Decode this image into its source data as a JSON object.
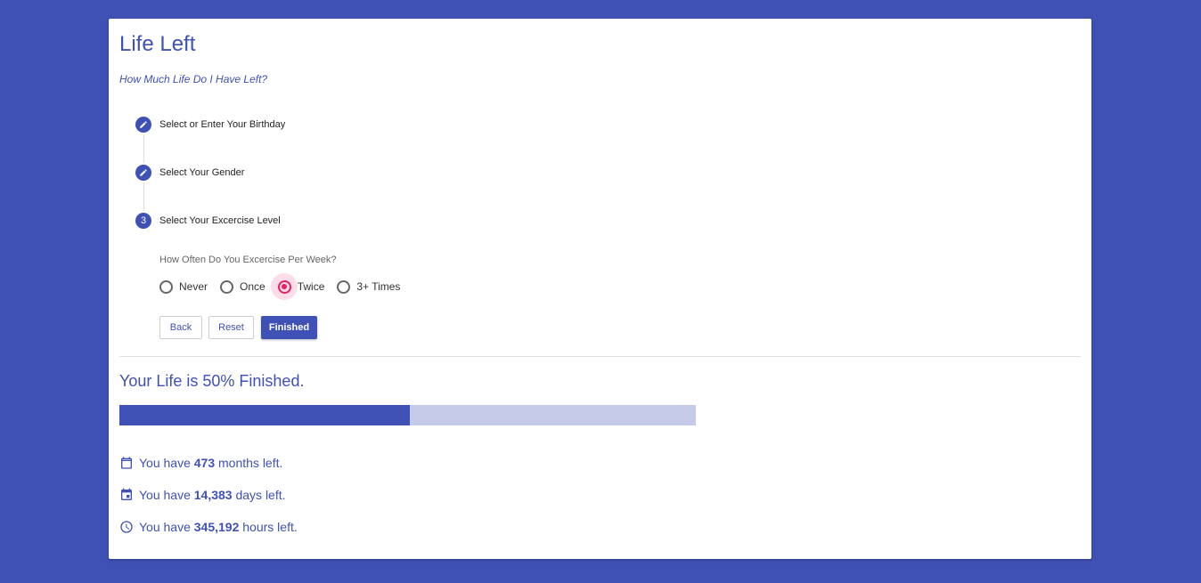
{
  "app": {
    "title": "Life Left",
    "subtitle": "How Much Life Do I Have Left?"
  },
  "steps": [
    {
      "label": "Select or Enter Your Birthday",
      "status": "edit",
      "badge": ""
    },
    {
      "label": "Select Your Gender",
      "status": "edit",
      "badge": ""
    },
    {
      "label": "Select Your Excercise Level",
      "status": "active",
      "badge": "3"
    }
  ],
  "exercise": {
    "question": "How Often Do You Excercise Per Week?",
    "options": [
      "Never",
      "Once",
      "Twice",
      "3+ Times"
    ],
    "selected": "Twice"
  },
  "buttons": {
    "back": "Back",
    "reset": "Reset",
    "finished": "Finished"
  },
  "result": {
    "heading": "Your Life is 50% Finished.",
    "progress_percent": 50.4,
    "stats": [
      {
        "prefix": "You have ",
        "value": "473",
        "suffix": " months left.",
        "icon": "calendar-icon"
      },
      {
        "prefix": "You have ",
        "value": "14,383",
        "suffix": " days left.",
        "icon": "event-icon"
      },
      {
        "prefix": "You have ",
        "value": "345,192",
        "suffix": " hours left.",
        "icon": "clock-icon"
      }
    ]
  },
  "colors": {
    "primary": "#3f51b5",
    "accent": "#e91e63",
    "progress_track": "#c5cae9"
  }
}
